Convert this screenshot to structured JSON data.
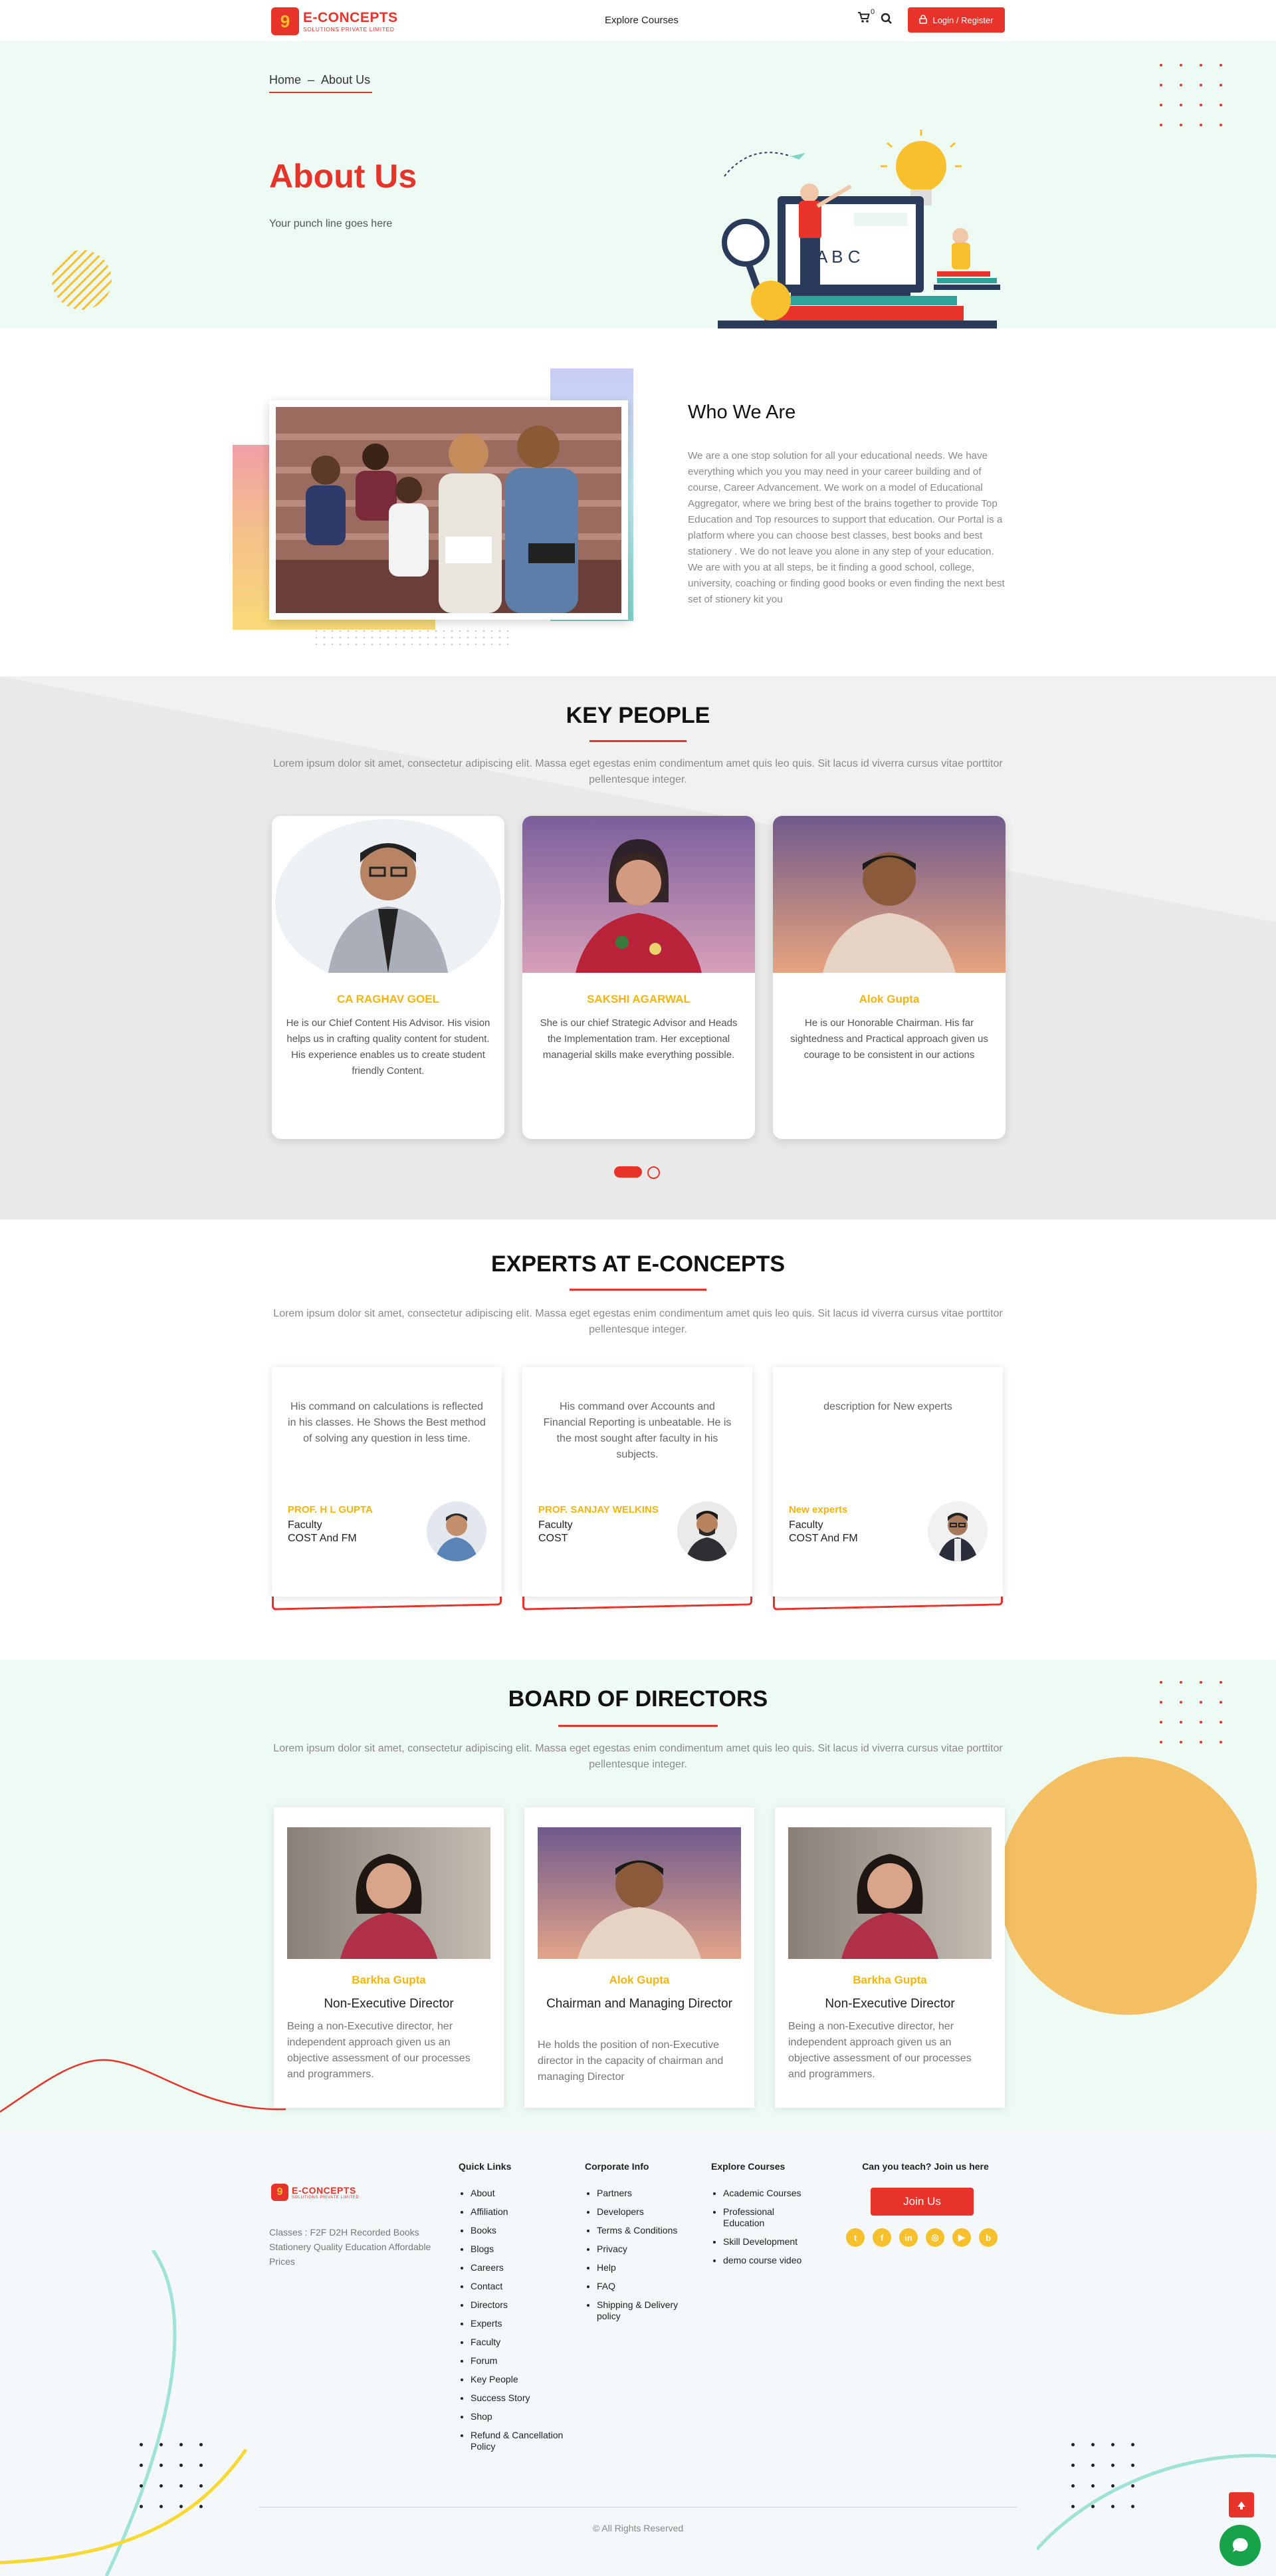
{
  "header": {
    "logo_title": "E-CONCEPTS",
    "logo_sub": "SOLUTIONS PRIVATE LIMITED",
    "logo_mark": "9",
    "nav_explore": "Explore Courses",
    "cart_count": "0",
    "login_label": "Login / Register"
  },
  "hero": {
    "breadcrumb_home": "Home",
    "breadcrumb_sep": "–",
    "breadcrumb_current": "About Us",
    "title": "About Us",
    "punch": "Your punch line goes here"
  },
  "who": {
    "title": "Who We Are",
    "text": "We are a one stop solution for all your educational needs. We have everything which you you may need in your career building and of course, Career Advancement. We work on a model of Educational Aggregator, where we bring best of the brains together to provide Top Education and Top resources to support that education. Our Portal is a platform where you can choose best classes, best books and best stationery . We do not leave you alone in any step of your education. We are with you at all steps, be it finding a good school, college, university, coaching or finding good books or even finding the next best set of stionery kit you"
  },
  "key_people": {
    "title": "KEY PEOPLE",
    "desc": "Lorem ipsum dolor sit amet, consectetur adipiscing elit. Massa eget egestas enim condimentum amet quis leo quis. Sit lacus id viverra cursus vitae porttitor pellentesque integer.",
    "people": [
      {
        "name": "CA RAGHAV GOEL",
        "desc": "He is our Chief Content His Advisor. His vision helps us in crafting quality content for student. His experience enables us to create student friendly Content."
      },
      {
        "name": "SAKSHI AGARWAL",
        "desc": "She is our chief Strategic Advisor and Heads the Implementation tram. Her exceptional managerial skills make everything possible."
      },
      {
        "name": "Alok Gupta",
        "desc": "He is our Honorable Chairman. His far sightedness and Practical approach given us courage to be consistent in our actions"
      }
    ]
  },
  "experts": {
    "title": "EXPERTS AT E-CONCEPTS",
    "desc": "Lorem ipsum dolor sit amet, consectetur adipiscing elit. Massa eget egestas enim condimentum amet quis leo quis. Sit lacus id viverra cursus vitae porttitor pellentesque integer.",
    "items": [
      {
        "desc": "His command on calculations is reflected in his classes. He Shows the Best method of solving any question in less time.",
        "name": "PROF. H L GUPTA",
        "role1": "Faculty",
        "role2": "COST And FM"
      },
      {
        "desc": "His command over Accounts and Financial Reporting is unbeatable. He is the most sought after faculty in his subjects.",
        "name": "PROF. SANJAY WELKINS",
        "role1": "Faculty",
        "role2": "COST"
      },
      {
        "desc": "description for New experts",
        "name": "New experts",
        "role1": "Faculty",
        "role2": "COST And FM"
      }
    ]
  },
  "board": {
    "title": "BOARD OF DIRECTORS",
    "desc": "Lorem ipsum dolor sit amet, consectetur adipiscing elit. Massa eget egestas enim condimentum amet quis leo quis. Sit lacus id viverra cursus vitae porttitor pellentesque integer.",
    "members": [
      {
        "name": "Barkha Gupta",
        "title": "Non-Executive Director",
        "desc": "Being a non-Executive director, her independent approach given us an objective assessment of our processes and programmers."
      },
      {
        "name": "Alok Gupta",
        "title": "Chairman and Managing Director",
        "desc": "He holds the position of non-Executive director in the capacity of chairman and managing Director"
      },
      {
        "name": "Barkha Gupta",
        "title": "Non-Executive Director",
        "desc": "Being a non-Executive director, her independent approach given us an objective assessment of our processes and programmers."
      }
    ]
  },
  "footer": {
    "tagline": "Classes : F2F D2H Recorded Books Stationery Quality Education Affordable Prices",
    "quick_links_title": "Quick Links",
    "quick_links": [
      "About",
      "Affiliation",
      "Books",
      "Blogs",
      "Careers",
      "Contact",
      "Directors",
      "Experts",
      "Faculty",
      "Forum",
      "Key People",
      "Success Story",
      "Shop",
      "Refund & Cancellation Policy"
    ],
    "corporate_title": "Corporate Info",
    "corporate": [
      "Partners",
      "Developers",
      "Terms & Conditions",
      "Privacy",
      "Help",
      "FAQ",
      "Shipping & Delivery policy"
    ],
    "explore_title": "Explore Courses",
    "explore": [
      "Academic Courses",
      "Professional Education",
      "Skill Development",
      "demo course video"
    ],
    "teach_title": "Can you teach? Join us here",
    "join_label": "Join Us",
    "social": [
      "twitter-icon",
      "facebook-icon",
      "linkedin-icon",
      "instagram-icon",
      "youtube-icon",
      "blog-icon"
    ],
    "copyright": "© All Rights Reserved"
  },
  "colors": {
    "brand_red": "#e8332a",
    "accent_yellow": "#f9c02d",
    "name_yellow": "#f5b50e",
    "hero_bg": "#eefaf4",
    "grey_bg": "#e9e9e9"
  }
}
